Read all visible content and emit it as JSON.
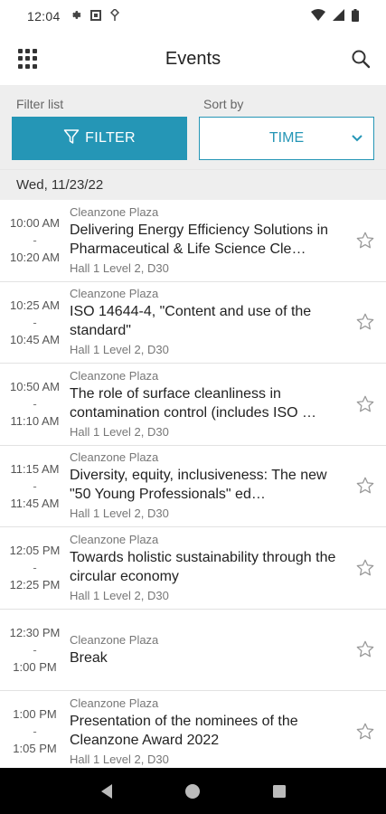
{
  "status_bar": {
    "time": "12:04",
    "left_icons": [
      "gear-icon",
      "media-icon",
      "vpn-key-icon"
    ],
    "right_icons": [
      "wifi-icon",
      "signal-icon",
      "battery-icon"
    ]
  },
  "app_bar": {
    "title": "Events",
    "menu_icon": "apps-grid-icon",
    "search_icon": "search-icon"
  },
  "controls": {
    "filter_label": "Filter list",
    "sort_label": "Sort by",
    "filter_button": "FILTER",
    "sort_value": "TIME",
    "accent_color": "#2596b6"
  },
  "date_header": "Wed, 11/23/22",
  "events": [
    {
      "start": "10:00 AM",
      "sep": "-",
      "end": "10:20 AM",
      "location": "Cleanzone Plaza",
      "title": "Delivering Energy Efficiency Solutions in Pharmaceutical & Life Science Cle…",
      "room": "Hall 1 Level 2, D30"
    },
    {
      "start": "10:25 AM",
      "sep": "-",
      "end": "10:45 AM",
      "location": "Cleanzone Plaza",
      "title": "ISO 14644-4, \"Content and use of the standard\"",
      "room": "Hall 1 Level 2, D30"
    },
    {
      "start": "10:50 AM",
      "sep": "-",
      "end": "11:10 AM",
      "location": "Cleanzone Plaza",
      "title": "The role of surface cleanliness in contamination control (includes ISO …",
      "room": "Hall 1 Level 2, D30"
    },
    {
      "start": "11:15 AM",
      "sep": "-",
      "end": "11:45 AM",
      "location": "Cleanzone Plaza",
      "title": "Diversity, equity, inclusiveness: The new \"50 Young Professionals\" ed…",
      "room": "Hall 1 Level 2, D30"
    },
    {
      "start": "12:05 PM",
      "sep": "-",
      "end": "12:25 PM",
      "location": "Cleanzone Plaza",
      "title": "Towards holistic sustainability through the circular economy",
      "room": "Hall 1 Level 2, D30"
    },
    {
      "start": "12:30 PM",
      "sep": "-",
      "end": "1:00 PM",
      "location": "Cleanzone Plaza",
      "title": "Break",
      "room": ""
    },
    {
      "start": "1:00 PM",
      "sep": "-",
      "end": "1:05 PM",
      "location": "Cleanzone Plaza",
      "title": "Presentation of the nominees of the Cleanzone Award 2022",
      "room": "Hall 1 Level 2, D30"
    }
  ],
  "nav_bar": [
    "back-icon",
    "home-icon",
    "recents-icon"
  ]
}
